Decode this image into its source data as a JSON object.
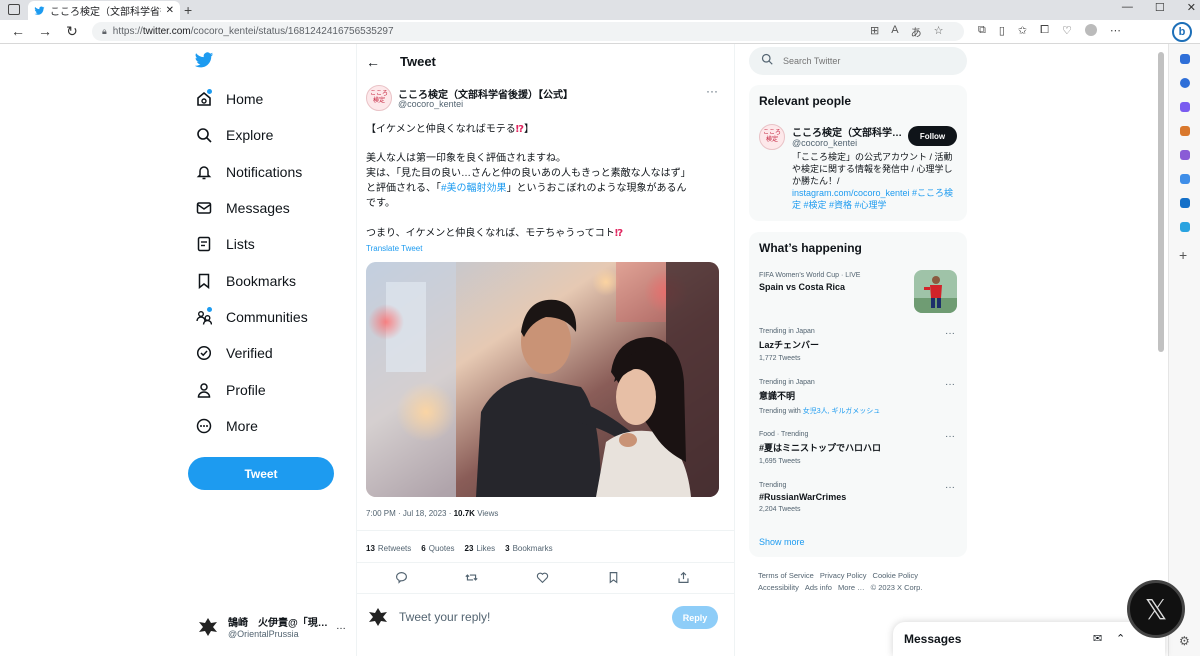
{
  "browser": {
    "tab_title": "こころ検定（文部科学省後援）【公",
    "url_prefix": "https://",
    "url_domain": "twitter.com",
    "url_path": "/cocoro_kentei/status/1681242416756535297"
  },
  "nav": {
    "items": [
      {
        "label": "Home",
        "icon": "home-icon"
      },
      {
        "label": "Explore",
        "icon": "search-icon"
      },
      {
        "label": "Notifications",
        "icon": "bell-icon"
      },
      {
        "label": "Messages",
        "icon": "mail-icon"
      },
      {
        "label": "Lists",
        "icon": "list-icon"
      },
      {
        "label": "Bookmarks",
        "icon": "bookmark-icon"
      },
      {
        "label": "Communities",
        "icon": "communities-icon"
      },
      {
        "label": "Verified",
        "icon": "verified-icon"
      },
      {
        "label": "Profile",
        "icon": "profile-icon"
      },
      {
        "label": "More",
        "icon": "more-icon"
      }
    ],
    "tweet_button": "Tweet",
    "account_name": "鵠崎　火伊責@「現…",
    "account_handle": "@OrientalPrussia",
    "account_more": "…"
  },
  "tweet": {
    "header": "Tweet",
    "author_avatar": "こころ\n検定",
    "author_name": "こころ検定（文部科学省後援）【公式】",
    "author_handle": "@cocoro_kentei",
    "line1": "【イケメンと仲良くなればモテる",
    "line1_end": "】",
    "line2": "美人な人は第一印象を良く評価されますね。",
    "line3": "実は、「見た目の良い…さんと仲の良いあの人もきっと素敵な人なはず」",
    "line4_a": "と評価される、「",
    "line4_link": "#美の輻射効果",
    "line4_b": "」というおこぼれのような現象があるん",
    "line5": "です。",
    "line6": "つまり、イケメンと仲良くなれば、モテちゃうってコト",
    "excl": "⁉",
    "translate": "Translate Tweet",
    "time": "7:00 PM · Jul 18, 2023 · ",
    "views_count": "10.7K",
    "views_label": "Views",
    "stats": [
      {
        "count": "13",
        "label": "Retweets"
      },
      {
        "count": "6",
        "label": "Quotes"
      },
      {
        "count": "23",
        "label": "Likes"
      },
      {
        "count": "3",
        "label": "Bookmarks"
      }
    ],
    "reply_placeholder": "Tweet your reply!",
    "reply_button": "Reply"
  },
  "right": {
    "search_placeholder": "Search Twitter",
    "relevant_title": "Relevant people",
    "rp_name": "こころ検定（文部科学…",
    "rp_handle": "@cocoro_kentei",
    "follow": "Follow",
    "rp_bio_1": "「こころ検定」の公式アカウント / 活動や検定に関する情報を発信中 / 心理学しか勝たん！/ ",
    "rp_bio_link": "instagram.com/cocoro_kentei #こころ検定 #検定 #資格 #心理学",
    "happening_title": "What’s happening",
    "trends": [
      {
        "cat": "FIFA Women's World Cup · LIVE",
        "title": "Spain vs Costa Rica",
        "count": ""
      },
      {
        "cat": "Trending in Japan",
        "title": "Lazチェンバー",
        "count": "1,772 Tweets"
      },
      {
        "cat": "Trending in Japan",
        "title": "意識不明",
        "count": "Trending with ",
        "with_links": "女児3人, ギルガメッシュ"
      },
      {
        "cat": "Food · Trending",
        "title": "#夏はミニストップでハロハロ",
        "count": "1,695 Tweets"
      },
      {
        "cat": "Trending",
        "title": "#RussianWarCrimes",
        "count": "2,204 Tweets"
      }
    ],
    "show_more": "Show more",
    "footer": [
      "Terms of Service",
      "Privacy Policy",
      "Cookie Policy",
      "Accessibility",
      "Ads info",
      "More …",
      "© 2023 X Corp."
    ]
  },
  "messages_drawer": {
    "title": "Messages"
  },
  "colors": {
    "accent": "#1d9bf0",
    "text": "#0f1419",
    "muted": "#536471"
  }
}
